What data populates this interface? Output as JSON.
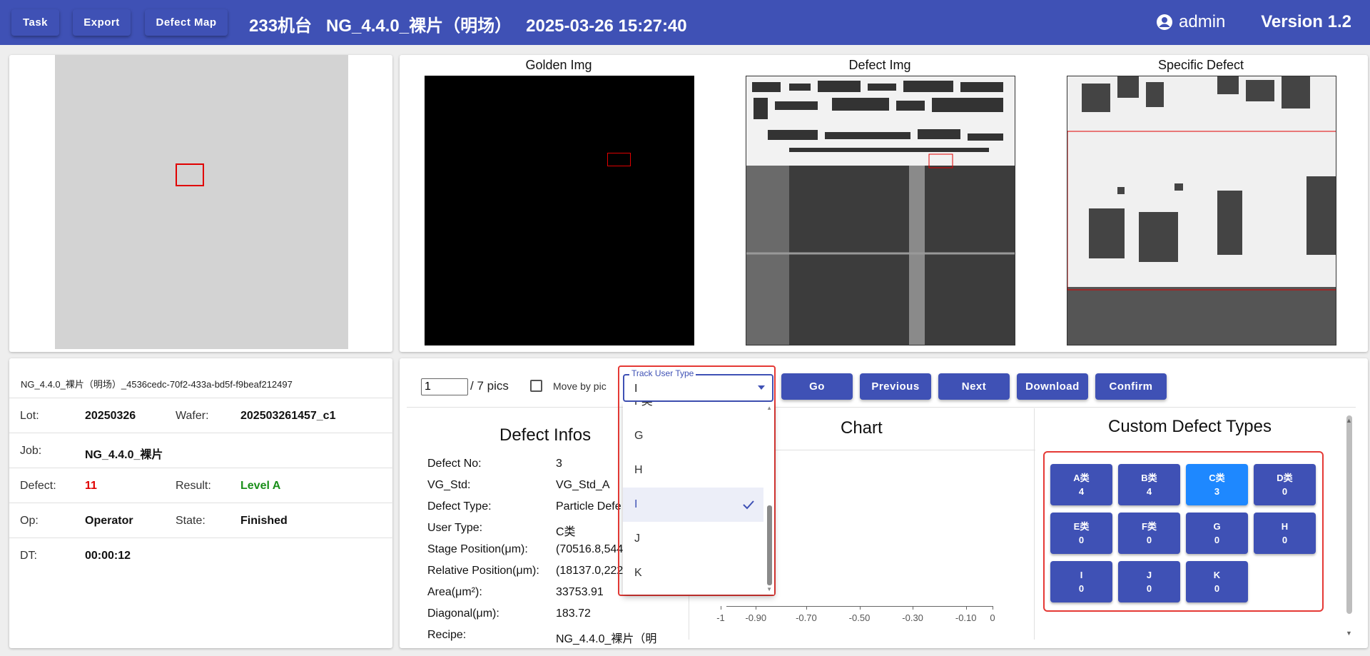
{
  "header": {
    "buttons": [
      "Task",
      "Export",
      "Defect Map"
    ],
    "title": "233机台   NG_4.4.0_裸片（明场）   2025-03-26 15:27:40",
    "user": "admin",
    "version": "Version 1.2",
    "bg_color": "#3f51b5"
  },
  "images": {
    "golden": "Golden Img",
    "defect": "Defect Img",
    "specific": "Specific Defect"
  },
  "info": {
    "filename": "NG_4.4.0_裸片（明场）_4536cedc-70f2-433a-bd5f-f9beaf212497",
    "lot_label": "Lot:",
    "lot": "20250326",
    "wafer_label": "Wafer:",
    "wafer": "202503261457_c1",
    "job_label": "Job:",
    "job": "NG_4.4.0_裸片",
    "defect_label": "Defect:",
    "defect": "11",
    "result_label": "Result:",
    "result": "Level A",
    "op_label": "Op:",
    "op": "Operator",
    "state_label": "State:",
    "state": "Finished",
    "dt_label": "DT:",
    "dt": "00:00:12",
    "defect_color": "#e00000",
    "result_color": "#1a8f1a"
  },
  "controls": {
    "page_value": "1",
    "page_total": "/ 7 pics",
    "move_by_pic": "Move by pic",
    "buttons": [
      "Go",
      "Previous",
      "Next",
      "Download",
      "Confirm"
    ]
  },
  "dropdown": {
    "legend": "Track User Type",
    "value": "I",
    "partial_item": "F类",
    "items": [
      "G",
      "H",
      "I",
      "J",
      "K"
    ],
    "selected": "I"
  },
  "defect_infos": {
    "title": "Defect Infos",
    "rows": [
      {
        "label": "Defect No:",
        "value": "3"
      },
      {
        "label": "VG_Std:",
        "value": "VG_Std_A"
      },
      {
        "label": "Defect Type:",
        "value": "Particle Defe"
      },
      {
        "label": "User Type:",
        "value": "C类"
      },
      {
        "label": "Stage Position(μm):",
        "value": "(70516.8,544"
      },
      {
        "label": "Relative Position(μm):",
        "value": "(18137.0,222"
      },
      {
        "label": "Area(μm²):",
        "value": "33753.91"
      },
      {
        "label": "Diagonal(μm):",
        "value": "183.72"
      },
      {
        "label": "Recipe:",
        "value": "NG_4.4.0_裸片（明"
      }
    ]
  },
  "chart": {
    "title": "Chart",
    "x_ticks": [
      "-1",
      "-0.90",
      "-0.70",
      "-0.50",
      "-0.30",
      "-0.10",
      "0"
    ],
    "chart_data": {
      "type": "scatter",
      "title": "Chart",
      "x_ticks": [
        "-1",
        "-0.90",
        "-0.70",
        "-0.50",
        "-0.30",
        "-0.10",
        "0"
      ],
      "xlim": [
        -1,
        0
      ],
      "series": []
    }
  },
  "custom_types": {
    "title": "Custom Defect Types",
    "items": [
      {
        "name": "A类",
        "count": "4"
      },
      {
        "name": "B类",
        "count": "4"
      },
      {
        "name": "C类",
        "count": "3"
      },
      {
        "name": "D类",
        "count": "0"
      },
      {
        "name": "E类",
        "count": "0"
      },
      {
        "name": "F类",
        "count": "0"
      },
      {
        "name": "G",
        "count": "0"
      },
      {
        "name": "H",
        "count": "0"
      },
      {
        "name": "I",
        "count": "0"
      },
      {
        "name": "J",
        "count": "0"
      },
      {
        "name": "K",
        "count": "0"
      }
    ],
    "active": "C类",
    "active_color": "#1e88ff"
  }
}
